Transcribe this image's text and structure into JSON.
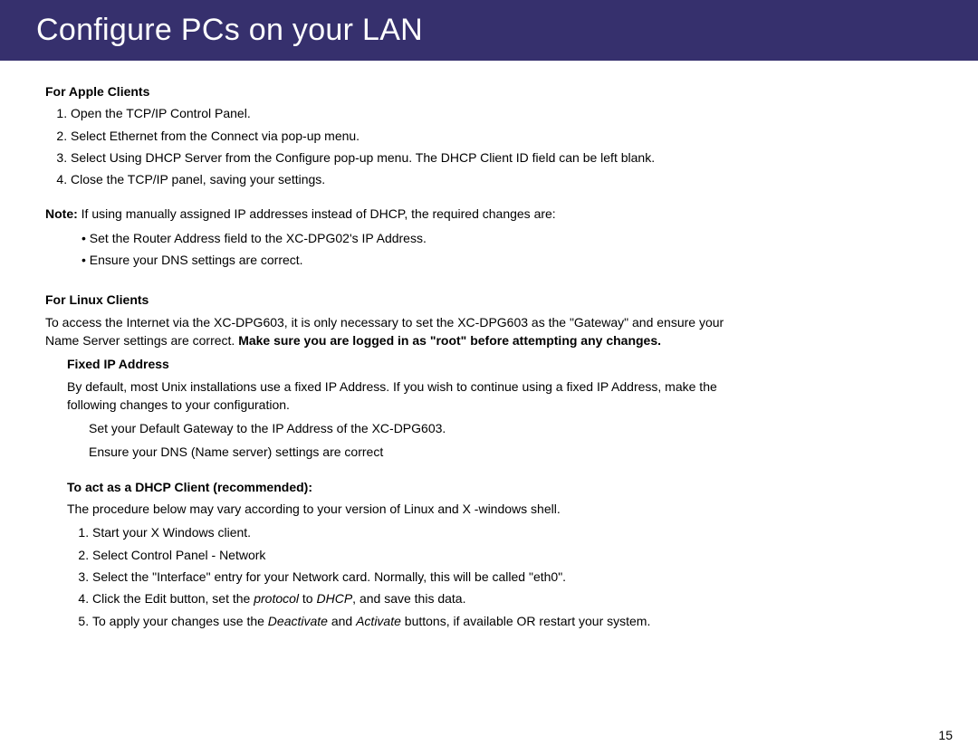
{
  "header": {
    "title": "Configure PCs on your LAN"
  },
  "apple": {
    "heading": "For Apple Clients",
    "steps": [
      "Open the TCP/IP Control Panel.",
      "Select Ethernet from the Connect via pop-up menu.",
      "Select Using DHCP Server from the Configure pop-up menu. The DHCP Client ID field can be left blank.",
      "Close the TCP/IP panel, saving your settings."
    ],
    "note_label": "Note:",
    "note_text": "If using manually assigned IP addresses instead of DHCP, the required changes are:",
    "note_bullets": [
      "Set the Router Address field to the XC-DPG02's IP Address.",
      "Ensure your DNS settings are correct."
    ]
  },
  "linux": {
    "heading": "For Linux Clients",
    "intro_plain": "To access the Internet via the XC-DPG603, it is only necessary to set the XC-DPG603 as the \"Gateway\" and ensure your Name Server settings are correct. ",
    "intro_bold": "Make sure you are logged in as \"root\" before attempting any changes.",
    "fixed": {
      "heading": "Fixed IP Address",
      "para": "By default, most Unix installations use a fixed IP Address. If you wish to continue using a fixed IP Address, make the following changes to your configuration.",
      "lines": [
        "Set your Default Gateway to the IP Address of the XC-DPG603.",
        "Ensure your DNS (Name server) settings are correct"
      ]
    },
    "dhcp": {
      "heading": "To act as a DHCP Client (recommended):",
      "para": "The procedure below may vary according to your version of Linux and X -windows shell.",
      "s1": "Start your X Windows client.",
      "s2": "Select Control Panel - Network",
      "s3": "Select the \"Interface\" entry for your Network card. Normally, this will be called \"eth0\".",
      "s4a": "Click the Edit button, set the ",
      "s4i": "protocol",
      "s4b": " to ",
      "s4c": "DHCP",
      "s4d": ", and save this data.",
      "s5a": "To apply your changes use the ",
      "s5i1": "Deactivate",
      "s5b": " and ",
      "s5i2": "Activate",
      "s5c": " buttons, if available OR restart your system."
    }
  },
  "page_number": "15"
}
